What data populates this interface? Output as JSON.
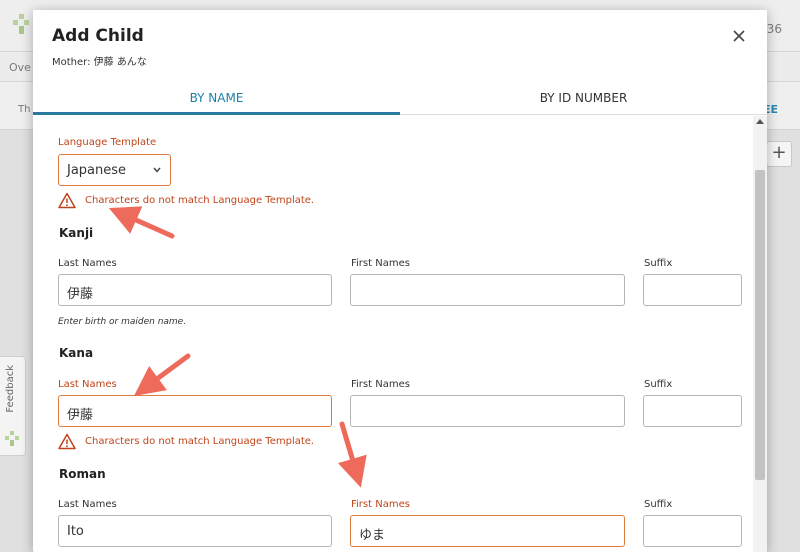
{
  "background": {
    "top_number": "36",
    "nav_text": "Ove",
    "sub_text": "Th",
    "sub_link": "EE",
    "plus_label": "+",
    "feedback_label": "Feedback"
  },
  "modal": {
    "title": "Add Child",
    "subtitle": "Mother: 伊藤 あんな",
    "tabs": [
      {
        "label": "BY NAME",
        "active": true
      },
      {
        "label": "BY ID NUMBER",
        "active": false
      }
    ]
  },
  "form": {
    "language_template": {
      "label": "Language Template",
      "value": "Japanese",
      "warning": "Characters do not match Language Template."
    },
    "kanji": {
      "heading": "Kanji",
      "last_label": "Last Names",
      "last_value": "伊藤",
      "first_label": "First Names",
      "first_value": "",
      "suffix_label": "Suffix",
      "suffix_value": "",
      "hint": "Enter birth or maiden name."
    },
    "kana": {
      "heading": "Kana",
      "last_label": "Last Names",
      "last_value": "伊藤",
      "first_label": "First Names",
      "first_value": "",
      "suffix_label": "Suffix",
      "suffix_value": "",
      "warning": "Characters do not match Language Template."
    },
    "roman": {
      "heading": "Roman",
      "last_label": "Last Names",
      "last_value": "Ito",
      "first_label": "First Names",
      "first_value": "ゆま",
      "suffix_label": "Suffix",
      "suffix_value": ""
    }
  },
  "colors": {
    "accent": "#1f7fa6",
    "error": "#c0441a",
    "error_border": "#e07a43",
    "annotation_arrow": "#ee6a5a"
  }
}
